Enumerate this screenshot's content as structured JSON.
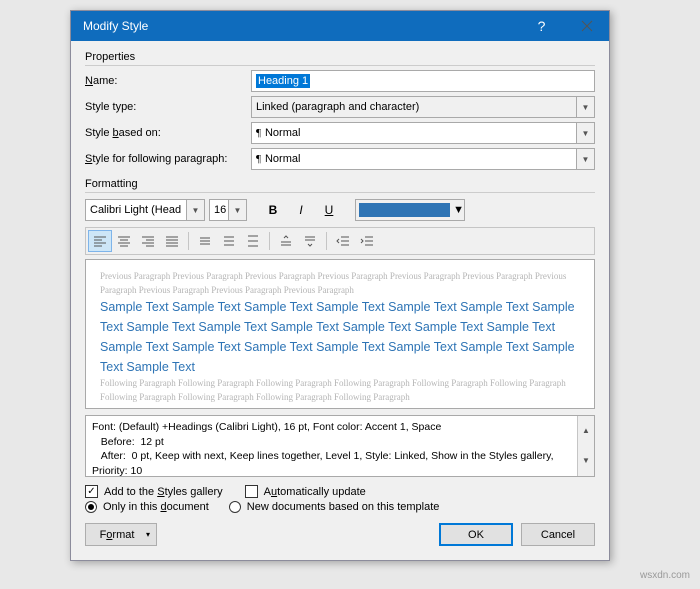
{
  "titlebar": {
    "title": "Modify Style"
  },
  "properties": {
    "group": "Properties",
    "name_label": "Name:",
    "name_value": "Heading 1",
    "type_label": "Style type:",
    "type_value": "Linked (paragraph and character)",
    "based_label": "Style based on:",
    "based_value": "Normal",
    "following_label": "Style for following paragraph:",
    "following_value": "Normal"
  },
  "formatting": {
    "group": "Formatting",
    "font": "Calibri Light (Head",
    "size": "16",
    "color": "#2e74b5",
    "prev_para": "Previous Paragraph Previous Paragraph Previous Paragraph Previous Paragraph Previous Paragraph Previous Paragraph Previous Paragraph Previous Paragraph Previous Paragraph Previous Paragraph",
    "sample": "Sample Text Sample Text Sample Text Sample Text Sample Text Sample Text Sample Text Sample Text Sample Text Sample Text Sample Text Sample Text Sample Text Sample Text Sample Text Sample Text Sample Text Sample Text Sample Text Sample Text Sample Text",
    "follow_para": "Following Paragraph Following Paragraph Following Paragraph Following Paragraph Following Paragraph Following Paragraph Following Paragraph Following Paragraph Following Paragraph Following Paragraph"
  },
  "description": {
    "line1": "Font: (Default) +Headings (Calibri Light), 16 pt, Font color: Accent 1, Space",
    "line2": "   Before:  12 pt",
    "line3": "   After:  0 pt, Keep with next, Keep lines together, Level 1, Style: Linked, Show in the Styles gallery, Priority: 10"
  },
  "options": {
    "add_gallery": "Add to the Styles gallery",
    "auto_update": "Automatically update",
    "only_doc": "Only in this document",
    "new_docs": "New documents based on this template"
  },
  "buttons": {
    "format": "Format",
    "ok": "OK",
    "cancel": "Cancel"
  },
  "watermark": "wsxdn.com"
}
